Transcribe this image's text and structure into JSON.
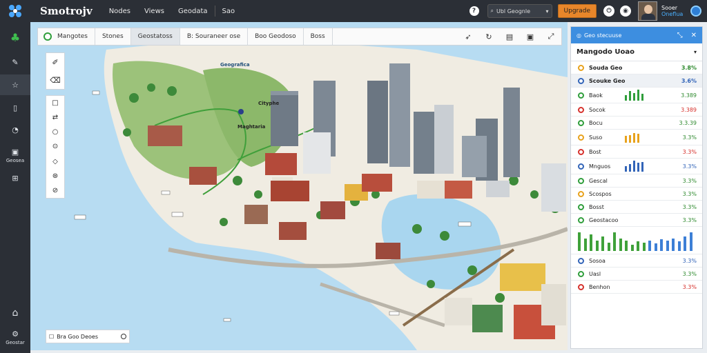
{
  "app": {
    "brand": "Smotrojv",
    "nav": [
      "Nodes",
      "Views",
      "Geodata",
      "Sao"
    ],
    "search_text": "Ubl Geognle",
    "upgrade_label": "Upgrade",
    "user_name": "Sooer",
    "user_role": "Oneflua"
  },
  "sidebar": {
    "items": [
      {
        "icon": "tree-icon",
        "glyph": "♣",
        "label": ""
      },
      {
        "icon": "wand-icon",
        "glyph": "✎",
        "label": ""
      },
      {
        "icon": "star-icon",
        "glyph": "☆",
        "label": ""
      },
      {
        "icon": "document-icon",
        "glyph": "▯",
        "label": ""
      },
      {
        "icon": "gauge-icon",
        "glyph": "◔",
        "label": ""
      },
      {
        "icon": "layers-icon",
        "glyph": "▣",
        "label": "Geosea"
      },
      {
        "icon": "grid-icon",
        "glyph": "⊞",
        "label": ""
      },
      {
        "icon": "home-icon",
        "glyph": "⌂",
        "label": ""
      },
      {
        "icon": "settings-icon",
        "glyph": "⚙",
        "label": "Geostar"
      }
    ]
  },
  "map_toolbar": {
    "tabs": [
      "Mangotes",
      "Stones",
      "Geostatoss",
      "B: Souraneer ose",
      "Boo Geodoso",
      "Boss"
    ],
    "active_index": 2,
    "icons": [
      "cursor-icon",
      "refresh-icon",
      "clipboard-icon",
      "save-icon",
      "expand-icon"
    ]
  },
  "map": {
    "labels": [
      "Geografica",
      "Cityphe",
      "Maghtaria"
    ],
    "scalebar_text": "Bra Goo Deoes"
  },
  "panel": {
    "header": "Geo stecuuse",
    "title": "Mangodo Uoao",
    "rows": [
      {
        "name": "Souda Geo",
        "value": "3.8%",
        "color": "#e8a21c"
      },
      {
        "name": "Scouke Geo",
        "value": "3.6%",
        "color": "#3264b8",
        "highlight": true
      },
      {
        "name": "Baok",
        "value": "3.389",
        "color": "#2f9e3b",
        "bars": [
          0.5,
          0.9,
          0.7,
          1.0,
          0.6
        ]
      },
      {
        "name": "Socok",
        "value": "3.389",
        "color": "#d6312c"
      },
      {
        "name": "Bocu",
        "value": "3.3.39",
        "color": "#2f9e3b"
      },
      {
        "name": "Suso",
        "value": "3.3%",
        "color": "#e8a21c",
        "bars": [
          0.6,
          0.7,
          0.9,
          0.8
        ]
      },
      {
        "name": "Bost",
        "value": "3.3%",
        "color": "#d6312c"
      },
      {
        "name": "Mnguos",
        "value": "3.3%",
        "color": "#3264b8",
        "bars": [
          0.5,
          0.7,
          1.0,
          0.8,
          0.9
        ]
      },
      {
        "name": "Gescal",
        "value": "3.3%",
        "color": "#2f9e3b"
      },
      {
        "name": "Scospos",
        "value": "3.3%",
        "color": "#e8a21c"
      },
      {
        "name": "Bosst",
        "value": "3.3%",
        "color": "#2f9e3b"
      },
      {
        "name": "Geostacoo",
        "value": "3.3%",
        "color": "#2f9e3b"
      },
      {
        "name": "Sosoa",
        "value": "3.3%",
        "color": "#3264b8"
      },
      {
        "name": "Uasl",
        "value": "3.3%",
        "color": "#2f9e3b"
      },
      {
        "name": "Benhon",
        "value": "3.3%",
        "color": "#d6312c"
      }
    ],
    "big_chart": [
      0.9,
      0.6,
      0.8,
      0.5,
      0.7,
      0.4,
      0.9,
      0.6,
      0.5,
      0.3,
      0.45,
      0.4,
      0.5,
      0.35,
      0.55,
      0.5,
      0.6,
      0.45,
      0.7,
      0.9
    ]
  }
}
